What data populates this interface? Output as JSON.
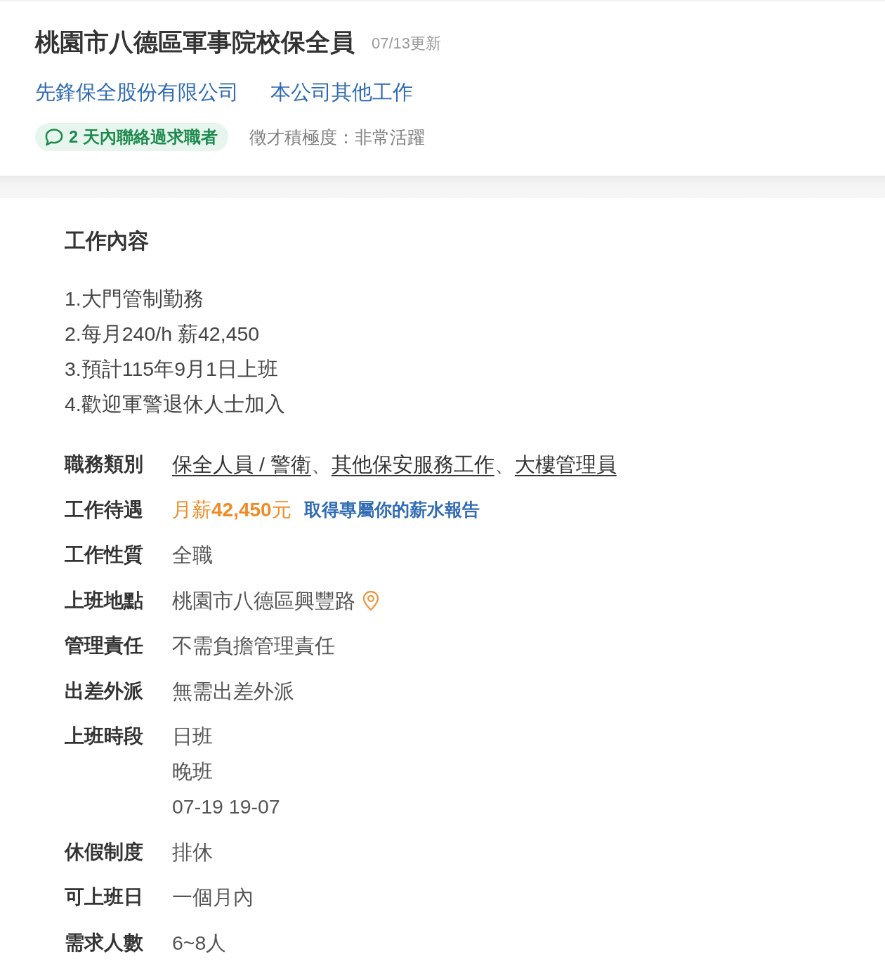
{
  "header": {
    "title": "桃園市八德區軍事院校保全員",
    "updated": "07/13更新",
    "company_link": "先鋒保全股份有限公司",
    "other_jobs_link": "本公司其他工作",
    "contact_badge": "**2** 天內聯絡過求職者",
    "hiring_activity": "徵才積極度：非常活躍"
  },
  "job_content": {
    "heading": "工作內容",
    "lines": [
      "1.大門管制勤務",
      "2.每月240/h 薪42,450",
      "3.預計115年9月1日上班",
      "4.歡迎軍警退休人士加入"
    ]
  },
  "details": [
    {
      "kind": "links",
      "label": "職務類別",
      "links": [
        {
          "text": "保全人員 / 警衛",
          "separator": "、"
        },
        {
          "text": "其他保安服務工作",
          "separator": "、"
        },
        {
          "text": "大樓管理員"
        }
      ]
    },
    {
      "kind": "salary",
      "label": "工作待遇",
      "salary": "月薪**42,450**元",
      "link": "取得專屬你的薪水報告"
    },
    {
      "kind": "text",
      "label": "工作性質",
      "lines": [
        "全職"
      ]
    },
    {
      "kind": "location",
      "label": "上班地點",
      "lines": [
        "桃園市八德區興豐路"
      ]
    },
    {
      "kind": "text",
      "label": "管理責任",
      "lines": [
        "不需負擔管理責任"
      ]
    },
    {
      "kind": "text",
      "label": "出差外派",
      "lines": [
        "無需出差外派"
      ]
    },
    {
      "kind": "text",
      "label": "上班時段",
      "lines": [
        "日班",
        "晚班",
        "07-19 19-07"
      ]
    },
    {
      "kind": "text",
      "label": "休假制度",
      "lines": [
        "排休"
      ]
    },
    {
      "kind": "text",
      "label": "可上班日",
      "lines": [
        "一個月內"
      ]
    },
    {
      "kind": "text",
      "label": "需求人數",
      "lines": [
        "6~8人"
      ]
    }
  ]
}
